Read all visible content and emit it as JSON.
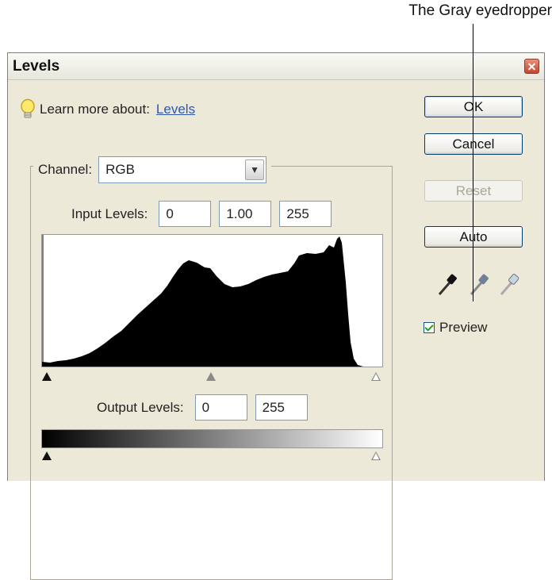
{
  "callout": {
    "label": "The Gray eyedropper"
  },
  "dialog": {
    "title": "Levels",
    "learn_more": {
      "prefix": "Learn more about:",
      "link": "Levels"
    },
    "channel": {
      "label": "Channel:",
      "value": "RGB"
    },
    "input_levels": {
      "label": "Input Levels:",
      "black": "0",
      "gamma": "1.00",
      "white": "255"
    },
    "output_levels": {
      "label": "Output Levels:",
      "black": "0",
      "white": "255"
    },
    "buttons": {
      "ok": "OK",
      "cancel": "Cancel",
      "reset": "Reset",
      "auto": "Auto"
    },
    "preview": {
      "label": "Preview",
      "checked": true
    },
    "eyedroppers": [
      "black-eyedropper-icon",
      "gray-eyedropper-icon",
      "white-eyedropper-icon"
    ]
  }
}
